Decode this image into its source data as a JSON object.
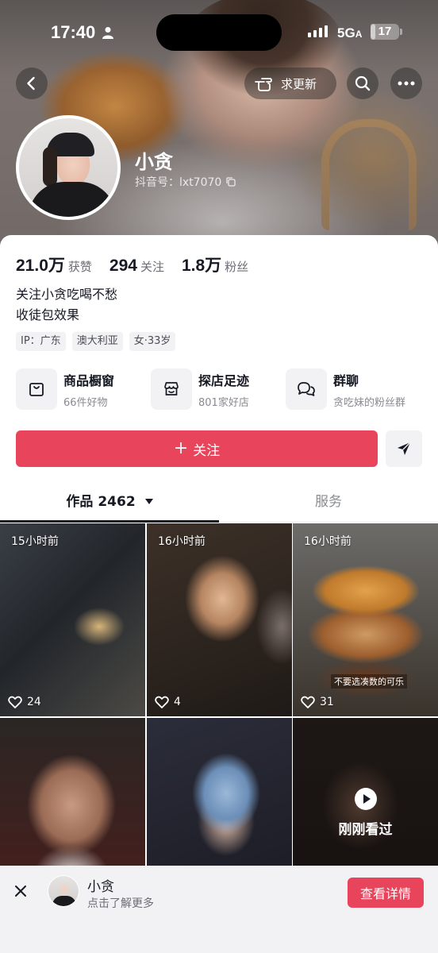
{
  "status_bar": {
    "time": "17:40",
    "network": "5G",
    "network_suffix": "A",
    "battery": "17",
    "battery_level": 0.17
  },
  "header": {
    "update_label": "求更新",
    "nickname": "小贪",
    "douyin_id": "抖音号：lxt7070"
  },
  "stats": [
    {
      "value": "21.0万",
      "label": "获赞"
    },
    {
      "value": "294",
      "label": "关注"
    },
    {
      "value": "1.8万",
      "label": "粉丝"
    }
  ],
  "bio": [
    "关注小贪吃喝不愁",
    "收徒包效果"
  ],
  "tags": [
    "IP：广东",
    "澳大利亚",
    "女·33岁"
  ],
  "features": [
    {
      "title": "商品橱窗",
      "sub": "66件好物",
      "icon": "shop-bag-icon"
    },
    {
      "title": "探店足迹",
      "sub": "801家好店",
      "icon": "store-icon"
    },
    {
      "title": "群聊",
      "sub": "贪吃妹的粉丝群",
      "icon": "chat-bubbles-icon"
    }
  ],
  "actions": {
    "follow_plus": "+",
    "follow_label": "关注"
  },
  "tabs": {
    "works_label": "作品",
    "works_count": "2462",
    "service_label": "服务"
  },
  "videos": [
    {
      "time": "15小时前",
      "likes": "24"
    },
    {
      "time": "16小时前",
      "likes": "4"
    },
    {
      "time": "16小时前",
      "likes": "31",
      "caption": "不要选凑数的可乐"
    },
    {
      "time": "",
      "likes": ""
    },
    {
      "time": "",
      "likes": ""
    },
    {
      "just_watched": "刚刚看过"
    }
  ],
  "banner": {
    "name": "小贪",
    "sub": "点击了解更多",
    "button": "查看详情"
  },
  "colors": {
    "accent": "#E8455C",
    "text": "#161823",
    "secondary": "#8A8B91",
    "chip_bg": "#F2F2F4"
  }
}
